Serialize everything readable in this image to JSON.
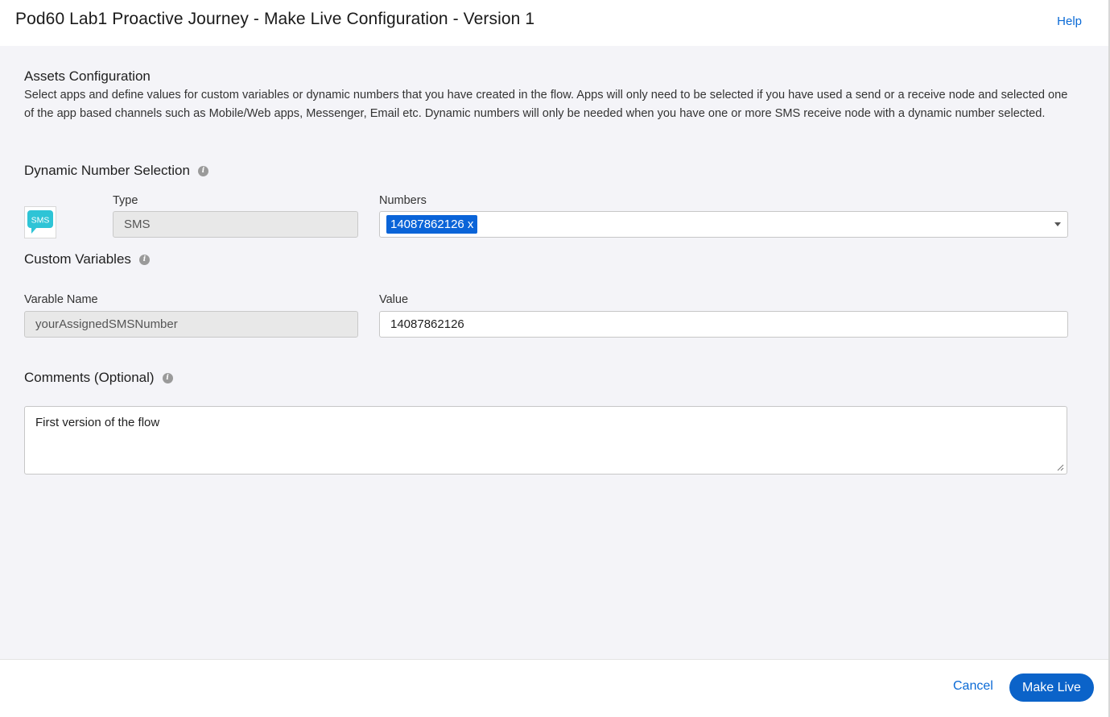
{
  "header": {
    "title": "Pod60 Lab1 Proactive Journey - Make Live Configuration - Version 1",
    "help_label": "Help"
  },
  "assets": {
    "title": "Assets Configuration",
    "description": "Select apps and define values for custom variables or dynamic numbers that you have created in the flow. Apps will only need to be selected if you have used a send or a receive node and selected one of the app based channels such as Mobile/Web apps, Messenger, Email etc. Dynamic numbers will only be needed when you have one or more SMS receive node with a dynamic number selected."
  },
  "dynamic_number": {
    "title": "Dynamic Number Selection",
    "icon": "info-icon",
    "channel_icon": "sms-icon",
    "channel_icon_text": "SMS",
    "type_label": "Type",
    "type_value": "SMS",
    "numbers_label": "Numbers",
    "selected_numbers": [
      "14087862126 x"
    ]
  },
  "custom_variables": {
    "title": "Custom Variables",
    "icon": "info-icon",
    "name_label": "Varable Name",
    "name_value": "yourAssignedSMSNumber",
    "value_label": "Value",
    "value_value": "14087862126"
  },
  "comments": {
    "title": "Comments (Optional)",
    "icon": "info-icon",
    "value": "First version of the flow"
  },
  "footer": {
    "cancel_label": "Cancel",
    "make_live_label": "Make Live"
  },
  "colors": {
    "accent": "#0b63c9",
    "link": "#0a6ad6",
    "sms_icon": "#2ec4d6",
    "background": "#f4f4f8"
  }
}
